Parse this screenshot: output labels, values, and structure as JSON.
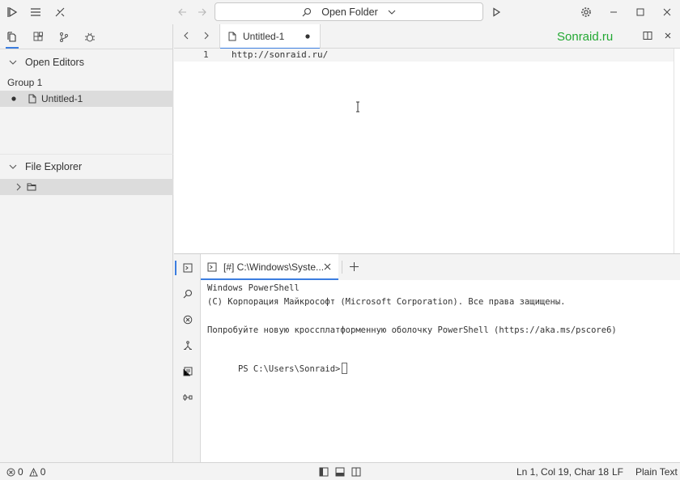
{
  "titlebar": {
    "search_label": "Open Folder"
  },
  "sidebar": {
    "open_editors_label": "Open Editors",
    "group_label": "Group 1",
    "open_file": "Untitled-1",
    "file_explorer_label": "File Explorer"
  },
  "editor": {
    "tab_label": "Untitled-1",
    "watermark": "Sonraid.ru",
    "line_number": "1",
    "code_line": "http://sonraid.ru/"
  },
  "panel": {
    "terminal_tab_label": "[#] C:\\Windows\\Syste...",
    "terminal_lines": [
      "Windows PowerShell",
      "(C) Корпорация Майкрософт (Microsoft Corporation). Все права защищены.",
      "",
      "Попробуйте новую кроссплатформенную оболочку PowerShell (https://aka.ms/pscore6)",
      "",
      "PS C:\\Users\\Sonraid>"
    ]
  },
  "statusbar": {
    "errors": "0",
    "warnings": "0",
    "cursor_position": "Ln 1, Col 19, Char 18",
    "line_ending": "LF",
    "language": "Plain Text"
  },
  "colors": {
    "accent": "#3b7de0",
    "watermark": "#22a832"
  }
}
